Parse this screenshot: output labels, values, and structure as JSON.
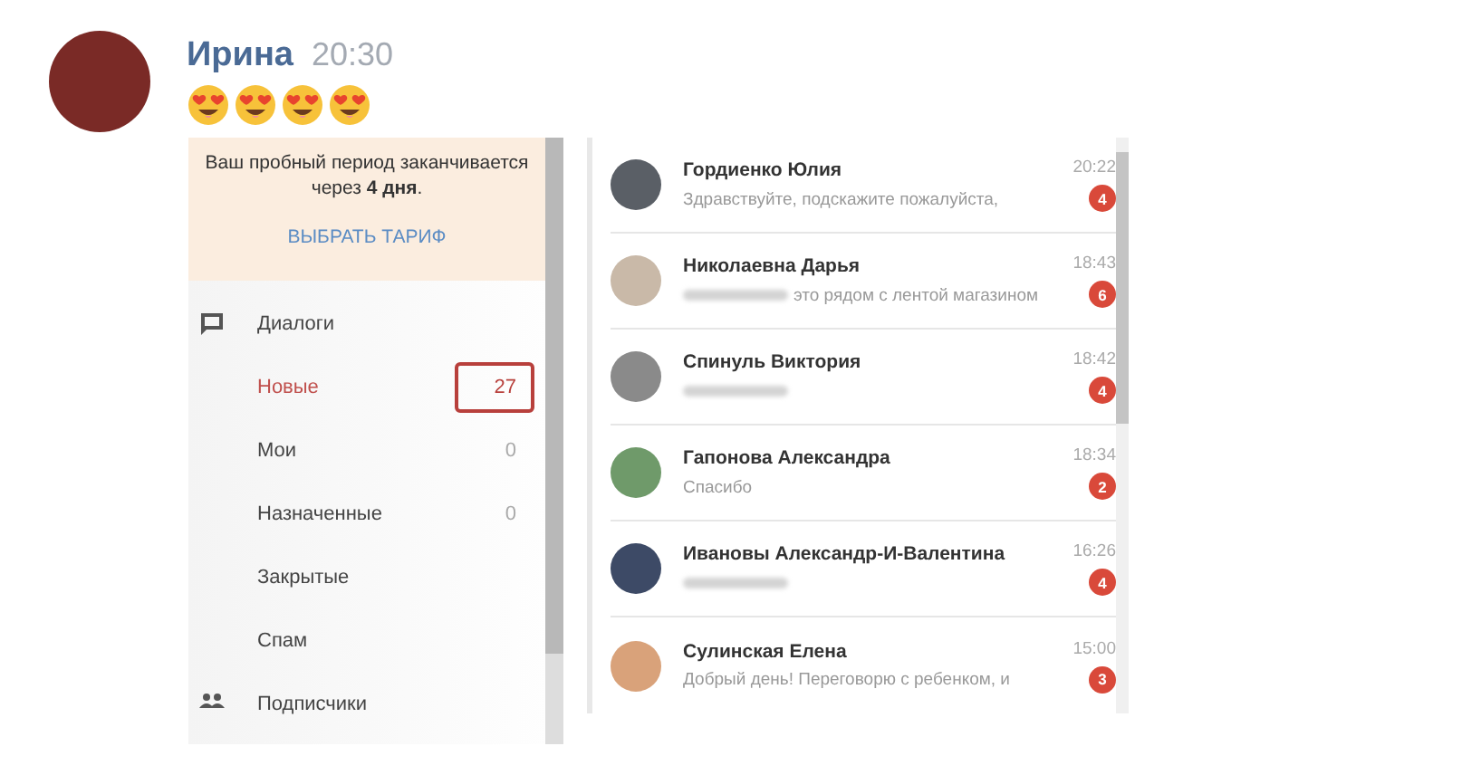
{
  "message": {
    "author": "Ирина",
    "time": "20:30",
    "emojis": [
      {
        "kind": "heart-eyes"
      },
      {
        "kind": "heart-eyes"
      },
      {
        "kind": "heart-eyes"
      },
      {
        "kind": "heart-eyes"
      }
    ]
  },
  "sidebar": {
    "trial_notice": "Ваш пробный период заканчивается через **4 дня**.",
    "plan_link": "ВЫБРАТЬ ТАРИФ",
    "items": [
      {
        "kind": "section",
        "label": "Диалоги"
      },
      {
        "kind": "item",
        "label": "Новые",
        "count": "27",
        "selected": true,
        "boxed": true
      },
      {
        "kind": "item",
        "label": "Мои",
        "count": "0",
        "selected": false,
        "boxed": false
      },
      {
        "kind": "item",
        "label": "Назначенные",
        "count": "0",
        "selected": false,
        "boxed": false
      },
      {
        "kind": "item",
        "label": "Закрытые",
        "selected": false,
        "boxed": false
      },
      {
        "kind": "item",
        "label": "Спам",
        "selected": false,
        "boxed": false
      },
      {
        "kind": "section",
        "label": "Подписчики"
      }
    ]
  },
  "dialogs": [
    {
      "name": "Гордиенко Юлия",
      "time": "20:22",
      "preview": "Здравствуйте, подскажите пожалуйста,",
      "preview_blurred": false,
      "unread": "4"
    },
    {
      "name": "Николаевна Дарья",
      "time": "18:43",
      "preview": "это рядом с лентой магазином",
      "preview_blurred": true,
      "unread": "6"
    },
    {
      "name": "Спинуль Виктория",
      "time": "18:42",
      "preview_blurred": true,
      "unread": "4"
    },
    {
      "name": "Гапонова Александра",
      "time": "18:34",
      "preview": "Спасибо",
      "preview_blurred": false,
      "unread": "2"
    },
    {
      "name": "Ивановы Александр-И-Валентина",
      "time": "16:26",
      "preview_blurred": true,
      "unread": "4"
    },
    {
      "name": "Сулинская Елена",
      "time": "15:00",
      "preview": "Добрый день! Переговорю с ребенком, и",
      "preview_blurred": false,
      "unread": "3"
    }
  ]
}
